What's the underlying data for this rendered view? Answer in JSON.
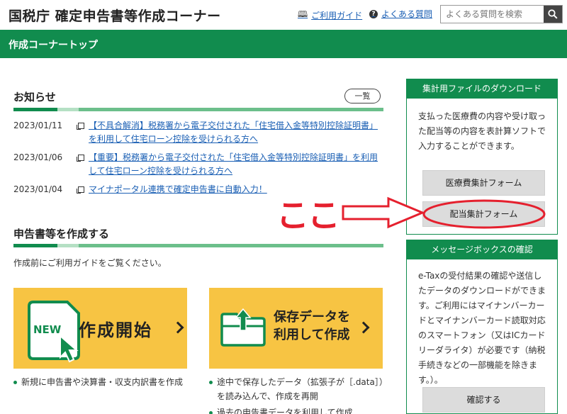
{
  "header": {
    "title": "国税庁 確定申告書等作成コーナー",
    "guide_link": "ご利用ガイド",
    "faq_link": "よくある質問",
    "search_placeholder": "よくある質問を検索"
  },
  "nav": {
    "page_title": "作成コーナートップ"
  },
  "news": {
    "title": "お知らせ",
    "more_label": "一覧",
    "items": [
      {
        "date": "2023/01/11",
        "text": "【不具合解消】税務署から電子交付された「住宅借入金等特別控除証明書」を利用して住宅ローン控除を受けられる方へ"
      },
      {
        "date": "2023/01/06",
        "text": "【重要】税務署から電子交付された「住宅借入金等特別控除証明書」を利用して住宅ローン控除を受けられる方へ"
      },
      {
        "date": "2023/01/04",
        "text": "マイナポータル連携で確定申告書に自動入力！"
      }
    ]
  },
  "create": {
    "title": "申告書等を作成する",
    "note": "作成前にご利用ガイドをご覧ください。",
    "start_label": "作成開始",
    "start_badge": "NEW",
    "saved_label_1": "保存データを",
    "saved_label_2": "利用して作成",
    "bullet_new": "新規に申告書や決算書・収支内訳書を作成",
    "bullet_saved_1": "途中で保存したデータ（拡張子が［.data］）",
    "bullet_saved_2": "を読み込んで、作成を再開",
    "bullet_saved_3": "過去の申告書データを利用して作成"
  },
  "sidebar": {
    "download": {
      "title": "集計用ファイルのダウンロード",
      "desc": "支払った医療費の内容や受け取った配当等の内容を表計算ソフトで入力することができます。",
      "btn_medical": "医療費集計フォーム",
      "btn_dividend": "配当集計フォーム"
    },
    "message": {
      "title": "メッセージボックスの確認",
      "desc": "e-Taxの受付結果の確認や送信したデータのダウンロードができます。ご利用にはマイナンバーカードとマイナンバーカード読取対応のスマートフォン（又はICカードリーダライタ）が必要です（納税手続きなどの一部機能を除きます。）。",
      "btn_confirm": "確認する"
    }
  },
  "annotation": {
    "text": "ここ",
    "color": "#e5202e"
  },
  "colors": {
    "brand_green": "#118c4e",
    "card_yellow": "#f7c443",
    "link_blue": "#1a5fb4"
  }
}
